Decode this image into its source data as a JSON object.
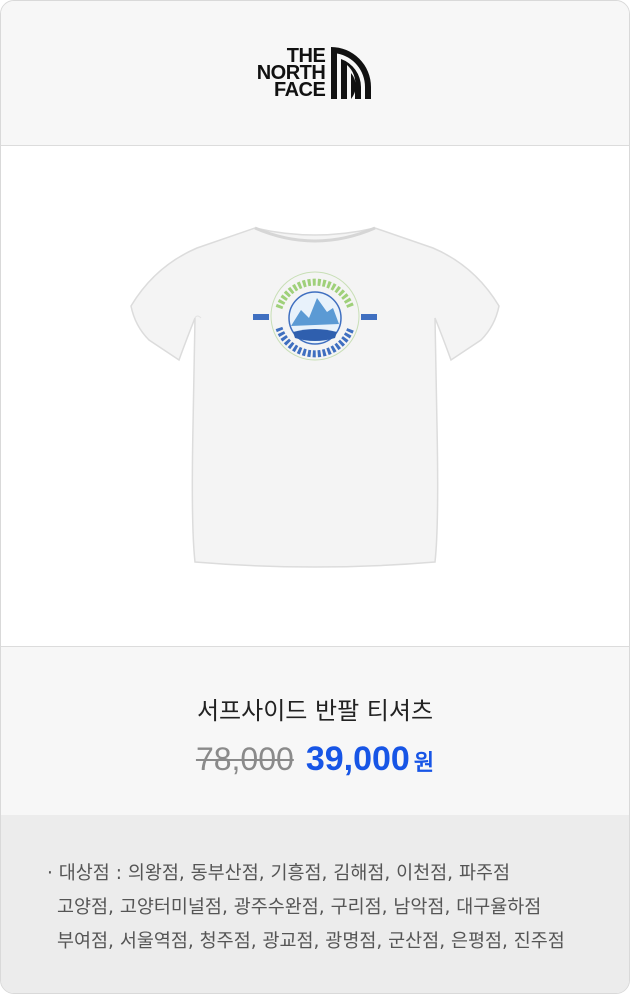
{
  "brand": {
    "logo_lines": [
      "THE",
      "NORTH",
      "FACE"
    ]
  },
  "product": {
    "image_icon": "white-tshirt-back-print-icon",
    "name": "서프사이드 반팔 티셔츠",
    "original_price": "78,000",
    "sale_price": "39,000",
    "currency": "원"
  },
  "stores": {
    "lines": [
      "· 대상점 : 의왕점, 동부산점, 기흥점, 김해점, 이천점, 파주점",
      "고양점, 고양터미널점, 광주수완점, 구리점, 남악점, 대구율하점",
      "부여점, 서울역점, 청주점, 광교점, 광명점, 군산점, 은평점, 진주점"
    ]
  },
  "colors": {
    "sale_price": "#1755e6",
    "original_price": "#8a8a8a",
    "panel_bg": "#f7f7f7",
    "stores_bg": "#ececec"
  }
}
